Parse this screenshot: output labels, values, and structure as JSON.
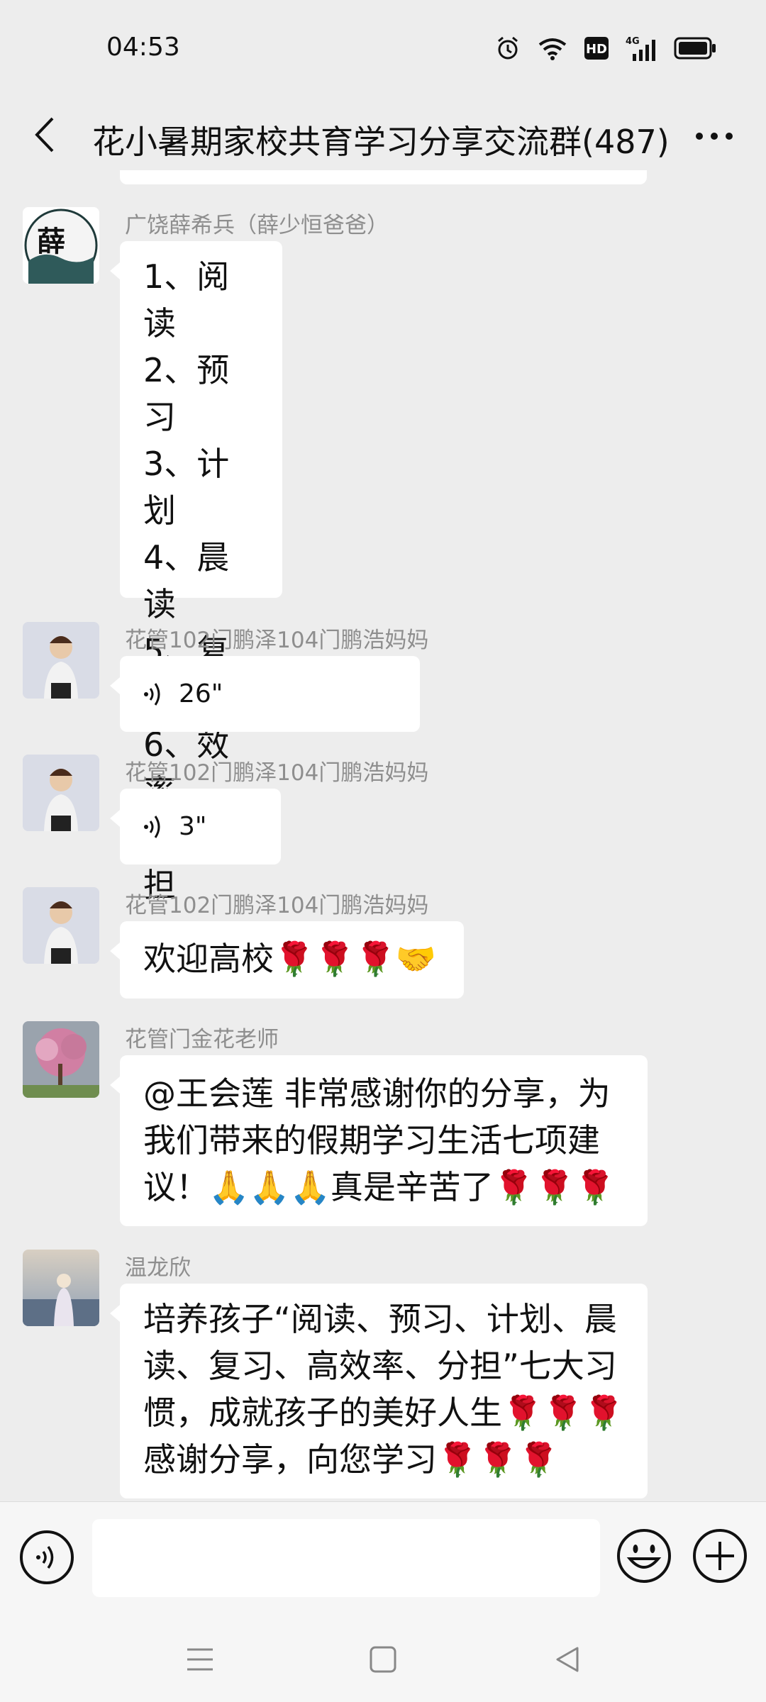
{
  "status_bar": {
    "time": "04:53",
    "icons": [
      "alarm-icon",
      "wifi-icon",
      "hd-icon",
      "signal-4g-icon",
      "battery-icon"
    ],
    "hd_label": "HD",
    "network_label": "4G"
  },
  "header": {
    "title": "花小暑期家校共育学习分享交流群(487)",
    "back_icon": "chevron-left-icon",
    "more_icon": "more-icon"
  },
  "messages": [
    {
      "sender": "广饶薛希兵（薛少恒爸爸）",
      "avatar_char": "薛",
      "lines": [
        "1、阅读",
        "2、预习",
        "3、计划",
        "4、晨读",
        "5、复习",
        "6、效率",
        "7、分担"
      ]
    },
    {
      "sender": "花管102门鹏泽104门鹏浩妈妈",
      "voice_duration": "26\""
    },
    {
      "sender": "花管102门鹏泽104门鹏浩妈妈",
      "voice_duration": "3\""
    },
    {
      "sender": "花管102门鹏泽104门鹏浩妈妈",
      "text": "欢迎高校🌹🌹🌹🤝"
    },
    {
      "sender": "花管门金花老师",
      "lines": [
        "@王会莲   非常感谢你的分享，为",
        "我们带来的假期学习生活七项建",
        "议！🙏🙏🙏真是辛苦了🌹🌹🌹"
      ]
    },
    {
      "sender": "温龙欣",
      "lines": [
        "培养孩子“阅读、预习、计划、晨",
        "读、复习、高效率、分担”七大习",
        "惯，成就孩子的美好人生🌹🌹🌹",
        "感谢分享，向您学习🌹🌹🌹"
      ]
    }
  ],
  "input_bar": {
    "voice_icon": "voice-toggle-icon",
    "placeholder": "",
    "emoji_icon": "emoji-icon",
    "plus_icon": "plus-icon"
  },
  "nav_bar": {
    "icons": [
      "menu-icon",
      "home-icon",
      "back-triangle-icon"
    ]
  },
  "colors": {
    "background": "#ededed",
    "bubble": "#ffffff",
    "sender_text": "#8e8e8e"
  }
}
